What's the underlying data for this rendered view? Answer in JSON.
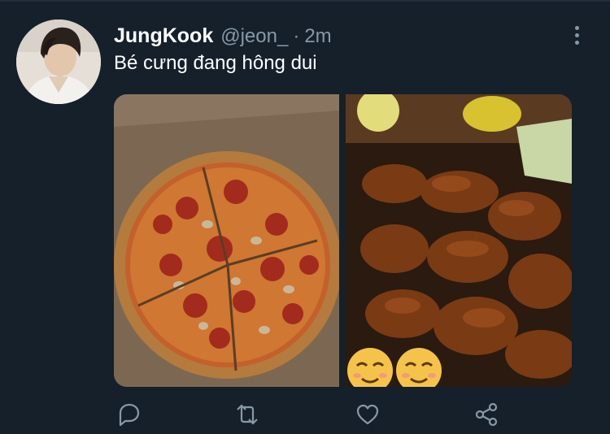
{
  "tweet": {
    "display_name": "JungKook",
    "handle": "@jeon_",
    "separator": "·",
    "time": "2m",
    "text": "Bé cưng đang hông dui"
  },
  "media": {
    "images": [
      {
        "subject": "pepperoni and mushroom pizza in a cardboard box"
      },
      {
        "subject": "fried chicken wings with two slightly-smiling-face emoji"
      }
    ],
    "emoji": "relieved-face"
  },
  "actions": {
    "icons": [
      "reply-icon",
      "retweet-icon",
      "like-icon",
      "share-icon"
    ]
  },
  "colors": {
    "background": "#15202b",
    "primary_text": "#ffffff",
    "secondary_text": "#8899a6",
    "divider": "#22303c"
  }
}
